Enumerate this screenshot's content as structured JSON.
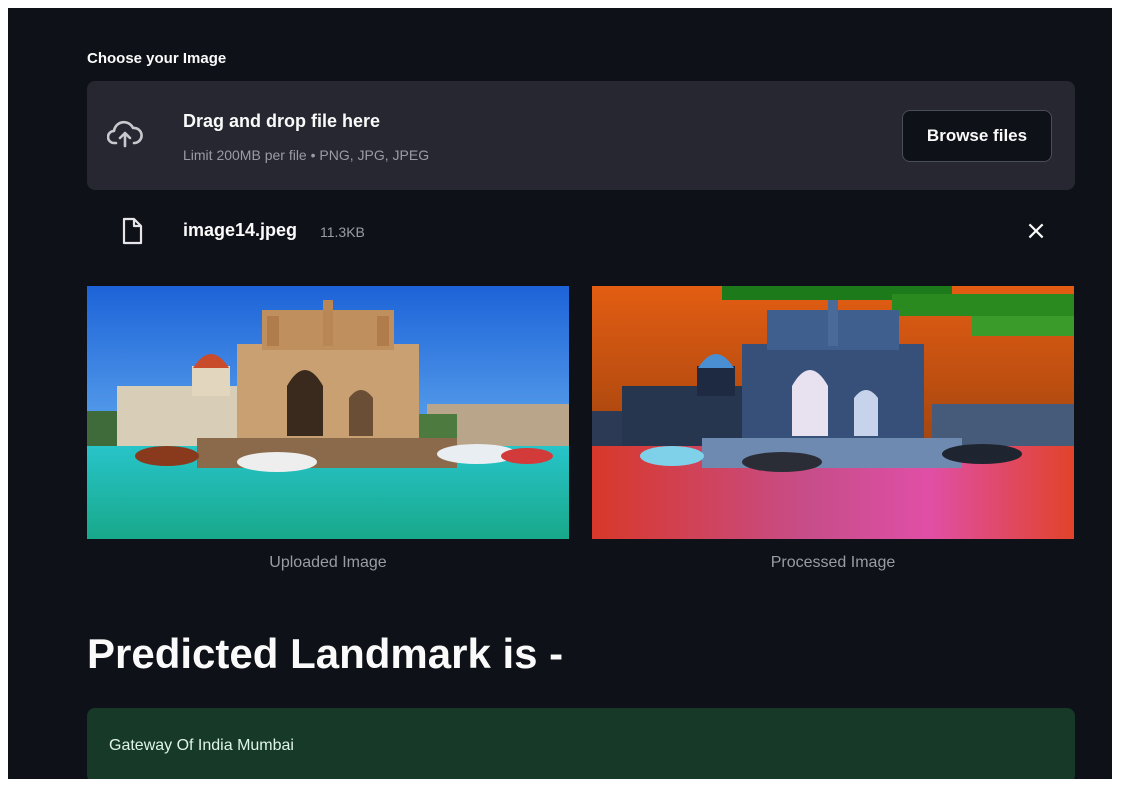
{
  "uploader": {
    "label": "Choose your Image",
    "drop_title": "Drag and drop file here",
    "limit_text": "Limit 200MB per file • PNG, JPG, JPEG",
    "browse_label": "Browse files",
    "icon": "cloud-upload-icon"
  },
  "file": {
    "name": "image14.jpeg",
    "size": "11.3KB",
    "icon": "file-icon",
    "remove_icon": "close-icon",
    "remove_glyph": "×"
  },
  "images": {
    "uploaded_caption": "Uploaded Image",
    "processed_caption": "Processed Image"
  },
  "prediction": {
    "heading": "Predicted Landmark is -",
    "result": "Gateway Of India Mumbai"
  },
  "colors": {
    "background": "#0e1117",
    "panel": "#262730",
    "success_bg": "#173928",
    "text": "#fafafa",
    "muted": "#9a9ca5"
  }
}
